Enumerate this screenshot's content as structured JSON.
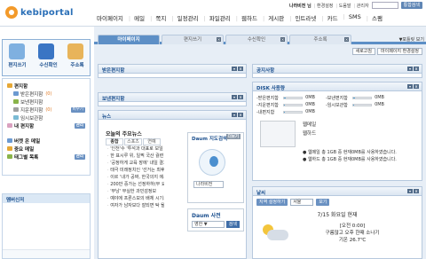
{
  "header": {
    "logo_text": "kebiportal",
    "user_name": "나라비전 님",
    "user_links": [
      "환경설정",
      "도움말",
      "관리자"
    ],
    "search_button": "통합검색",
    "menu": [
      "마이페이지",
      "메일",
      "쪽지",
      "일정관리",
      "파일관리",
      "웹하드",
      "게시판",
      "인트라넷",
      "카드",
      "SMS",
      "스팸"
    ]
  },
  "sidebar": {
    "apps": [
      "편지쓰기",
      "수신확인",
      "주소록"
    ],
    "tree": [
      {
        "label": "편지함",
        "count": "",
        "type": "root",
        "icon": "mail-icon"
      },
      {
        "label": "받은편지함",
        "count": "(0)",
        "type": "child",
        "icon": "inbox-icon"
      },
      {
        "label": "보낸편지함",
        "count": "",
        "type": "child",
        "icon": "sent-icon"
      },
      {
        "label": "지운편지함",
        "count": "(0)",
        "type": "child",
        "icon": "trash-icon",
        "manage": "비우기"
      },
      {
        "label": "임시보관함",
        "count": "",
        "type": "child",
        "icon": "temp-icon"
      },
      {
        "label": "내 편지함",
        "count": "",
        "type": "root",
        "icon": "mybox-icon",
        "manage": "관리"
      },
      {
        "label": "버켓 온 메일",
        "count": "",
        "type": "root",
        "icon": "mail-icon"
      },
      {
        "label": "중요 메일",
        "count": "",
        "type": "root",
        "icon": "star-icon"
      },
      {
        "label": "태그별 목록",
        "count": "",
        "type": "root",
        "icon": "tag-icon",
        "manage": "관리"
      }
    ],
    "contacts_title": "멤버신저"
  },
  "main": {
    "tabs": [
      "마이페이지",
      "편지쓰기",
      "수신확인",
      "주소록"
    ],
    "tab_extra": "▼포틀릿 보기",
    "actions": [
      "새로고침",
      "마이페이지 환경설정"
    ],
    "panels": {
      "inbox": "받은편지함",
      "outbox": "보낸편지함",
      "notice": "공지사항",
      "disk": "DISK 사용량",
      "weather": "날씨",
      "news": "뉴스"
    },
    "disk_rows": [
      {
        "label": "-받은편지함",
        "value": "0MB",
        "label2": "-보낸편지함",
        "value2": "0MB",
        "fill": 0.1,
        "fill2": 0.08
      },
      {
        "label": "-지운편지함",
        "value": "0MB",
        "label2": "-임시보관함",
        "value2": "0MB",
        "fill": 0.05,
        "fill2": 0.05
      },
      {
        "label": "-내편지함",
        "value": "0MB",
        "label2": "",
        "value2": "",
        "fill": 0.05,
        "fill2": 0
      }
    ],
    "disk_notes": [
      "웹메일",
      "웹하드"
    ],
    "disk_summary": [
      "● 웹메일 총 1GB 중 현재0MB를 사용하였습니다.",
      "● 웹하드 총 1GB 중 현재0MB를 사용하였습니다."
    ],
    "weather": {
      "button_label": "지역 설정하기",
      "region": "서울",
      "go": "보기",
      "date": "7/15 화요일 현재",
      "lines": [
        "[오전 0:00]",
        "구름많고 오후 한때 소나기",
        "기온 26.7℃"
      ]
    },
    "news": {
      "title": "오늘의 주요뉴스",
      "tabs": [
        "종합",
        "스포츠",
        "연예"
      ],
      "items": [
        "'인천'수 '투석과 대표로 보일 때'",
        "한 표시루 위, 일찍 국산 궐련",
        "'공정하게 교육 장에' 내일 결과",
        "태극 미래정치인 '선거는 최후'",
        "이르 '내가 공짜, 한국의지 에서'",
        "200만 중가는 선정하하(무 요시)",
        "'무낭' 부실한 과민감정보",
        "예야에 프론스보의 배체 시기로",
        "여자가 남자보다 잘되면 탁 될"
      ]
    },
    "map": {
      "title": "Daum 지도검색",
      "more": "더보기",
      "input": "나라비전"
    },
    "dict": {
      "title": "Daum 사전",
      "input": "영한 ▼",
      "button": "검색"
    }
  }
}
